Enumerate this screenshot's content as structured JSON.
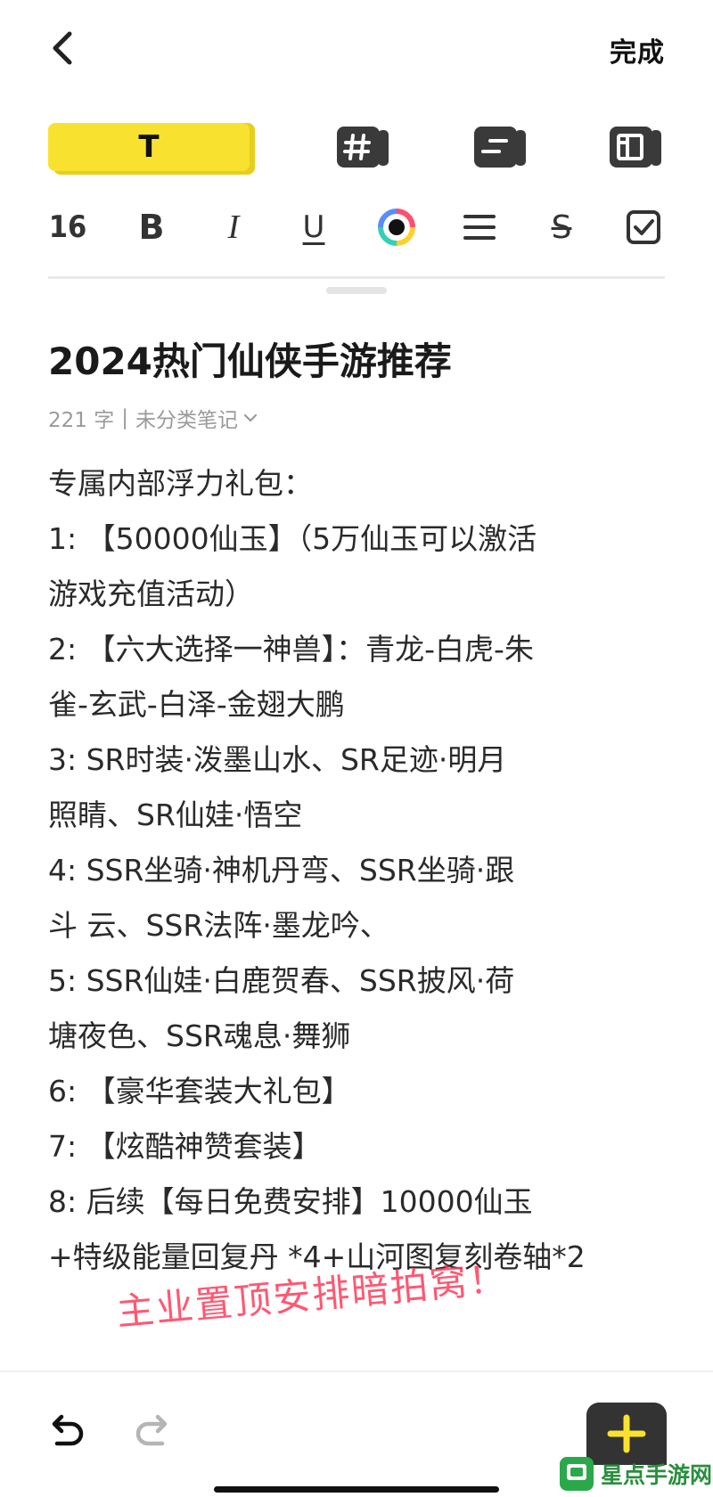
{
  "header": {
    "done_label": "完成"
  },
  "style_tabs": {
    "text_tab_label": "T"
  },
  "toolbar": {
    "font_size": "16",
    "bold": "B",
    "italic": "I",
    "underline": "U",
    "strikethrough": "S"
  },
  "note": {
    "title": "2024热门仙侠手游推荐",
    "word_count": "221 字",
    "category": "未分类笔记",
    "lines": [
      "专属内部浮力礼包：",
      "1:  【50000仙玉】（5万仙玉可以激活",
      "游戏充值活动）",
      "2:  【六大选择一神兽】：青龙-白虎-朱",
      "雀-玄武-白泽-金翅大鹏",
      "3:  SR时装·泼墨山水、SR足迹·明月",
      "照睛、SR仙娃·悟空",
      "4:  SSR坐骑·神机丹弯、SSR坐骑·跟",
      "斗    云、SSR法阵·墨龙吟、",
      "5:  SSR仙娃·白鹿贺春、SSR披风·荷",
      "塘夜色、SSR魂息·舞狮",
      "6:  【豪华套装大礼包】",
      "7: 【炫酷神赞套装】",
      "8: 后续【每日免费安排】10000仙玉",
      "+特级能量回复丹 *4+山河图复刻卷轴*2"
    ],
    "stamp_text": "主业置顶安排暗拍窝！"
  },
  "watermark": {
    "text": "星点手游网"
  },
  "colors": {
    "accent_yellow": "#f9e22f",
    "stamp_red": "#ff3c5a"
  },
  "icons": [
    "back-icon",
    "hashtag-icon",
    "list-style-icon",
    "layout-icon",
    "color-wheel-icon",
    "align-icon",
    "checkbox-icon",
    "undo-icon",
    "redo-icon",
    "plus-icon"
  ]
}
